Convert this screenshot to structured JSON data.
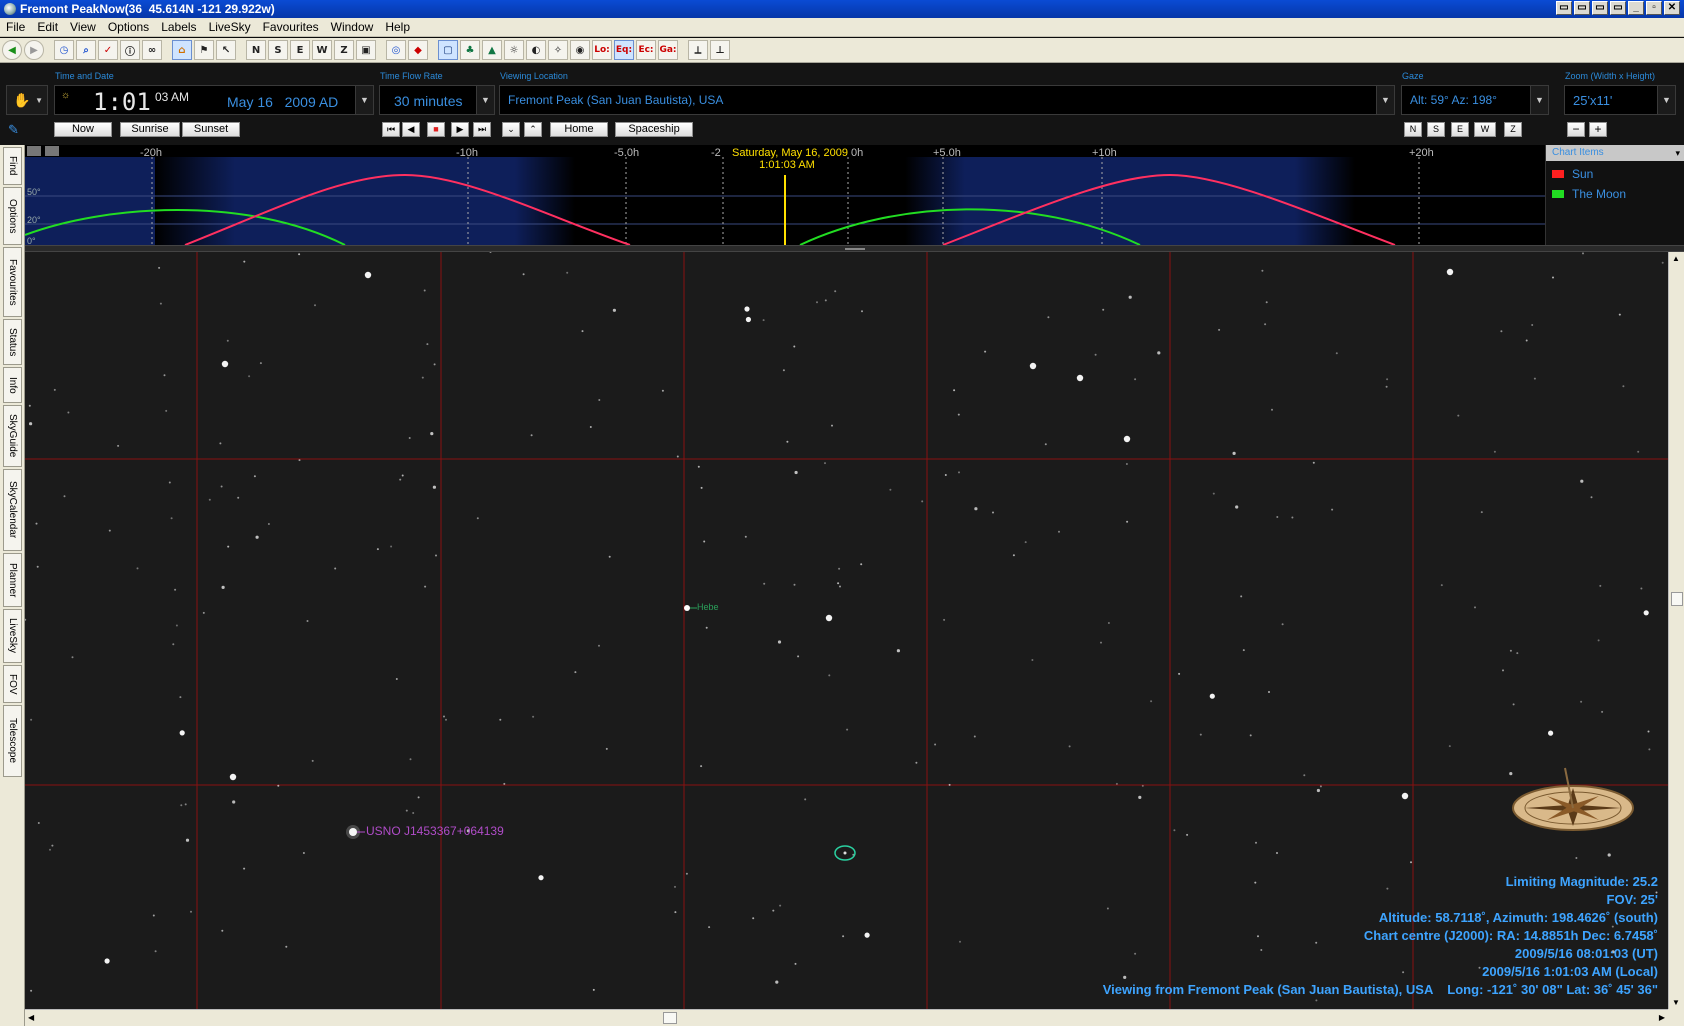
{
  "window": {
    "title": "Fremont PeakNow(36  45.614N -121 29.922w)",
    "controls": [
      "▭",
      "▭",
      "▭",
      "▭",
      "_",
      "▫",
      "✕"
    ]
  },
  "menu": [
    "File",
    "Edit",
    "View",
    "Options",
    "Labels",
    "LiveSky",
    "Favourites",
    "Window",
    "Help"
  ],
  "toolbar_icons": [
    "back-icon",
    "forward-icon",
    "clock-icon",
    "magnifier-icon",
    "chart-icon",
    "info-icon",
    "binoculars-icon",
    "home-icon",
    "flag-icon",
    "cursor-icon",
    "compass-n-icon",
    "compass-s-icon",
    "compass-e-icon",
    "compass-w-icon",
    "compass-z-icon",
    "screen-icon",
    "globe-icon",
    "diamond-icon",
    "frame-icon",
    "tree-icon",
    "mountain-icon",
    "sun-icon",
    "moon-icon",
    "constellation-icon",
    "target-icon",
    "local-grid-icon",
    "equatorial-grid-icon",
    "ecliptic-grid-icon",
    "galactic-grid-icon",
    "telescope-icon",
    "eyepiece-icon"
  ],
  "toolbar_labels": {
    "n": "N",
    "s": "S",
    "e": "E",
    "w": "W",
    "z": "Z",
    "lo": "Lo:",
    "eq": "Eq:",
    "ec": "Ec:",
    "ga": "Ga:"
  },
  "controls": {
    "time_and_date_label": "Time and Date",
    "time_value": "1:01",
    "time_seconds": "03",
    "time_ampm": "AM",
    "date_value": "May 16   2009 AD",
    "time_flow_label": "Time Flow Rate",
    "time_flow_value": "30 minutes",
    "viewing_location_label": "Viewing Location",
    "viewing_location_value": "Fremont Peak (San Juan Bautista), USA",
    "gaze_label": "Gaze",
    "gaze_value": "Alt: 59° Az: 198°",
    "zoom_label": "Zoom (Width x Height)",
    "zoom_value": "25'x11'",
    "buttons": {
      "now": "Now",
      "sunrise": "Sunrise",
      "sunset": "Sunset",
      "home": "Home",
      "spaceship": "Spaceship",
      "n": "N",
      "s": "S",
      "e": "E",
      "w": "W",
      "z": "Z",
      "minus": "−",
      "plus": "+"
    }
  },
  "side_tabs": [
    "Find",
    "Options",
    "Favourites",
    "Status",
    "Info",
    "SkyGuide",
    "SkyCalendar",
    "Planner",
    "LiveSky",
    "FOV",
    "Telescope"
  ],
  "timeline": {
    "tick_labels": [
      "-20h",
      "-10h",
      "-5.0h",
      "-2",
      "0h",
      "+5.0h",
      "+10h",
      "+20h"
    ],
    "altitude_labels": [
      "50°",
      "20°",
      "0°"
    ],
    "current_time_title": "Saturday, May 16, 2009",
    "current_time": "1:01:03 AM",
    "legend_header": "Chart Items",
    "legend": [
      {
        "name": "Sun",
        "color": "#ff2020"
      },
      {
        "name": "The Moon",
        "color": "#22dd22"
      }
    ]
  },
  "sky": {
    "labels": [
      {
        "text": "Hebe",
        "color": "#2aa05a"
      },
      {
        "text": "USNO J1453367+064139",
        "color": "#b04cc8"
      }
    ],
    "info": {
      "limiting_magnitude": "Limiting Magnitude: 25.2",
      "fov": "FOV: 25'",
      "altitude_azimuth": "Altitude: 58.7118˚, Azimuth: 198.4626˚ (south)",
      "chart_centre": "Chart centre (J2000): RA: 14.8851h Dec: 6.7458˚",
      "ut": "2009/5/16 08:01:03 (UT)",
      "local": "2009/5/16 1:01:03 AM (Local)",
      "viewing_from": "Viewing from Fremont Peak (San Juan Bautista), USA    Long: -121˚ 30' 08\" Lat: 36˚ 45' 36\""
    }
  }
}
